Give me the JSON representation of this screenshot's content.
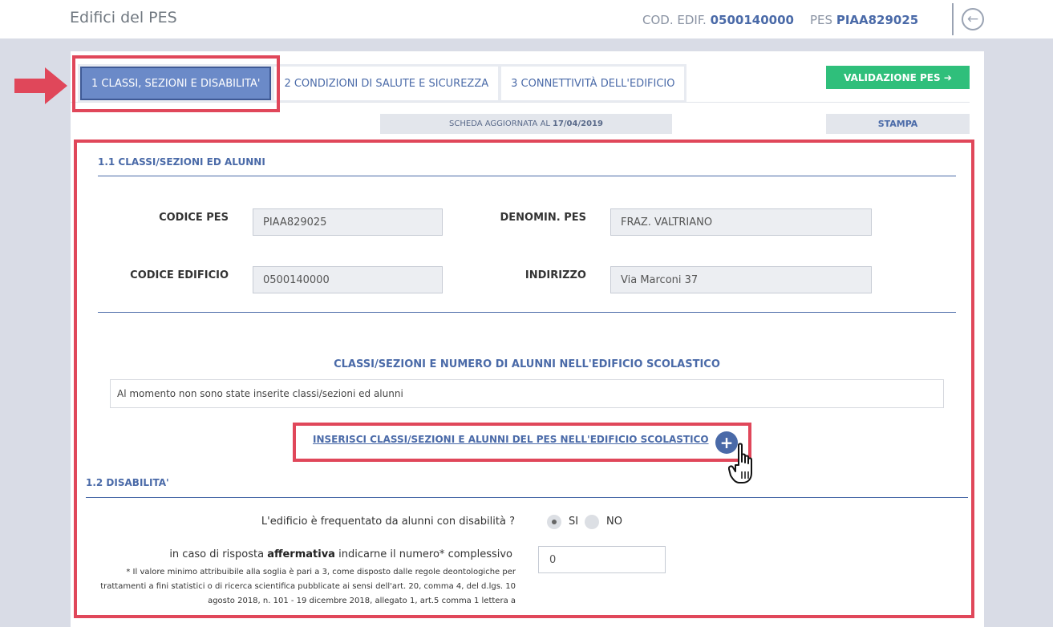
{
  "header": {
    "title": "Edifici del PES",
    "cod_edif_label": "COD. EDIF.",
    "cod_edif_value": "0500140000",
    "pes_label": "PES",
    "pes_value": "PIAA829025",
    "back_icon": "←"
  },
  "tabs": [
    {
      "label": "1 CLASSI, SEZIONI E DISABILITA'",
      "active": true
    },
    {
      "label": "2 CONDIZIONI DI SALUTE E SICUREZZA",
      "active": false
    },
    {
      "label": "3 CONNETTIVITÀ DELL'EDIFICIO",
      "active": false
    }
  ],
  "toolbar": {
    "validate_label": "VALIDAZIONE PES ➔",
    "sched_label": "SCHEDA AGGIORNATA AL",
    "sched_date": "17/04/2019",
    "print_label": "STAMPA"
  },
  "section1": {
    "title": "1.1 CLASSI/SEZIONI ED ALUNNI",
    "fields": {
      "codice_pes_label": "CODICE PES",
      "codice_pes_value": "PIAA829025",
      "denomin_label": "DENOMIN. PES",
      "denomin_value": "FRAZ. VALTRIANO",
      "codice_edificio_label": "CODICE EDIFICIO",
      "codice_edificio_value": "0500140000",
      "indirizzo_label": "INDIRIZZO",
      "indirizzo_value": "Via Marconi 37"
    },
    "classes_heading": "CLASSI/SEZIONI E NUMERO DI ALUNNI NELL'EDIFICIO SCOLASTICO",
    "empty_message": "Al momento non sono state inserite classi/sezioni ed alunni",
    "insert_link": "INSERISCI CLASSI/SEZIONI E ALUNNI DEL PES NELL'EDIFICIO SCOLASTICO",
    "plus_icon": "+"
  },
  "section2": {
    "title": "1.2 DISABILITA'",
    "question": "L'edificio è frequentato da alunni con disabilità ?",
    "options": [
      "SI",
      "NO"
    ],
    "selected": "SI",
    "count_prefix": "in caso di risposta",
    "count_bold": "affermativa",
    "count_suffix": "indicarne il numero* complessivo",
    "count_value": "0",
    "note": "* Il valore minimo attribuibile alla soglia è pari a 3, come disposto dalle regole deontologiche per trattamenti a fini statistici o di ricerca scientifica pubblicate ai sensi dell'art. 20, comma 4, del d.lgs. 10 agosto 2018, n. 101 - 19 dicembre 2018, allegato 1, art.5 comma 1 lettera a"
  },
  "colors": {
    "accent": "#4a6aa8",
    "active_tab": "#6b8ac8",
    "validate_green": "#2fbf7b",
    "highlight_red": "#e0475a",
    "background": "#d9dce6"
  },
  "icons": {
    "arrow": "arrow-right-icon",
    "back": "back-arrow-icon",
    "plus": "plus-circle-icon",
    "hand": "hand-pointer-icon"
  }
}
